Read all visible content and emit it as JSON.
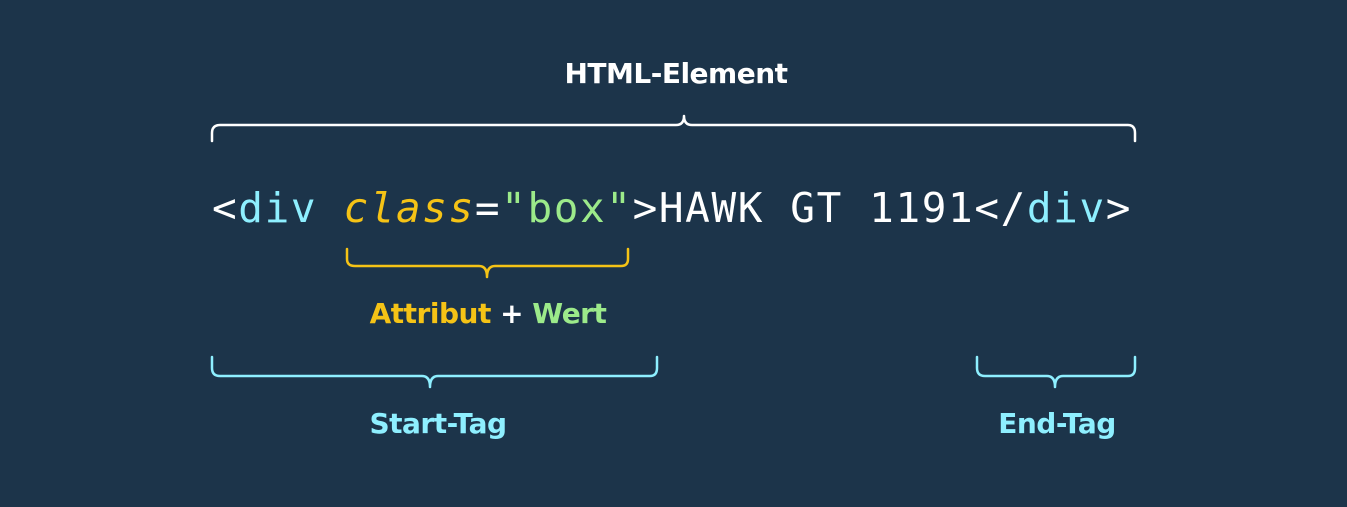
{
  "diagram": {
    "title": "HTML-Element",
    "code": {
      "open_bracket": "<",
      "tag_name": "div",
      "space": " ",
      "attribute": "class",
      "equals": "=",
      "value": "\"box\"",
      "close_bracket": ">",
      "content": "HAWK GT 1191",
      "end_open": "</",
      "end_tag_name": "div",
      "end_close": ">"
    },
    "attribute_label": {
      "attribut": "Attribut",
      "plus": "+",
      "wert": "Wert"
    },
    "start_tag_label": "Start-Tag",
    "end_tag_label": "End-Tag"
  },
  "colors": {
    "background": "#1c344a",
    "white": "#ffffff",
    "tag": "#8eefff",
    "attribute": "#f5c316",
    "value": "#9cea8a"
  }
}
